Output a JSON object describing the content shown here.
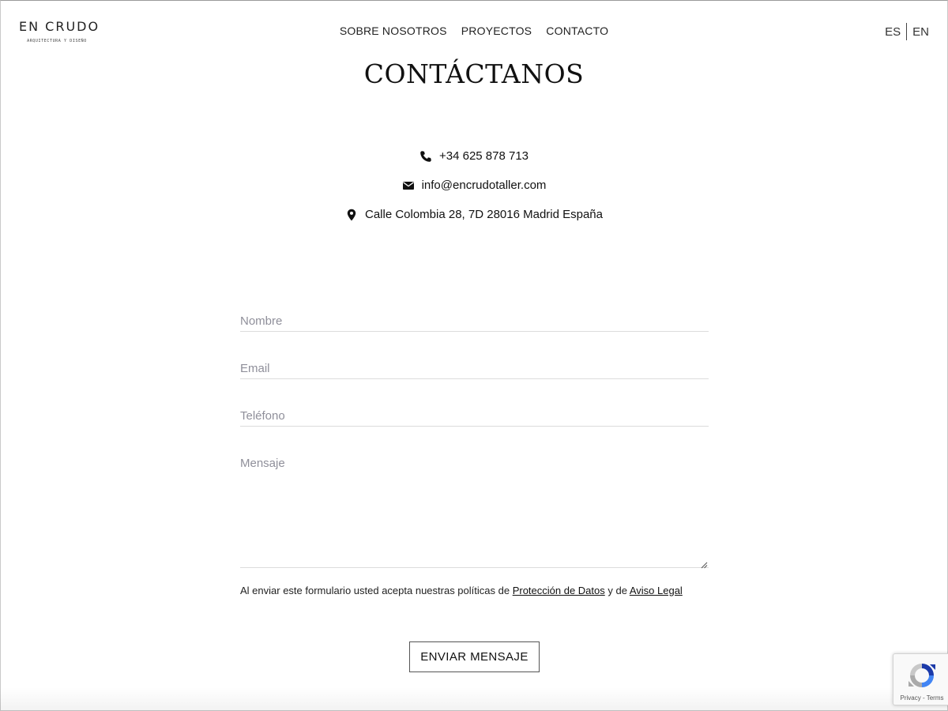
{
  "brand": {
    "name": "EN CRUDO",
    "tagline": "ARQUITECTURA Y DISEÑO"
  },
  "nav": {
    "items": [
      {
        "label": "SOBRE NOSOTROS"
      },
      {
        "label": "PROYECTOS"
      },
      {
        "label": "CONTACTO"
      }
    ]
  },
  "language": {
    "options": [
      "ES",
      "EN"
    ]
  },
  "page": {
    "title": "CONTÁCTANOS"
  },
  "contact": {
    "phone": "+34 625 878 713",
    "email": "info@encrudotaller.com",
    "address": "Calle Colombia 28, 7D 28016 Madrid España",
    "icons": [
      "phone-icon",
      "envelope-icon",
      "map-pin-icon"
    ]
  },
  "form": {
    "name_placeholder": "Nombre",
    "email_placeholder": "Email",
    "phone_placeholder": "Teléfono",
    "message_placeholder": "Mensaje",
    "consent_prefix": "Al enviar este formulario usted acepta nuestras políticas de ",
    "consent_link_privacy": "Protección de Datos",
    "consent_middle": " y de ",
    "consent_link_legal": "Aviso Legal",
    "submit_label": "ENVIAR MENSAJE"
  },
  "recaptcha": {
    "privacy": "Privacy",
    "separator": " - ",
    "terms": "Terms"
  },
  "colors": {
    "text": "#1a1a1a",
    "placeholder": "#8f8f9a",
    "field_underline": "#dcdcdc",
    "button_border": "#555555",
    "background": "#ffffff"
  }
}
